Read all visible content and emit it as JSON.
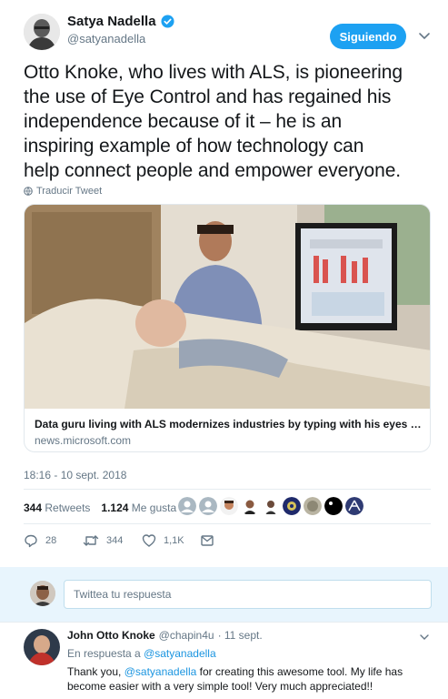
{
  "author": {
    "name": "Satya Nadella",
    "handle": "@satyanadella",
    "follow_label": "Siguiendo"
  },
  "tweet": {
    "text": "Otto Knoke, who lives with ALS, is pioneering\nthe use of Eye Control and has regained his\nindependence because of it – he is an\ninspiring example of how technology can\nhelp connect people and empower everyone.",
    "translate_label": "Traducir Tweet",
    "timestamp": "18:16 - 10 sept. 2018"
  },
  "card": {
    "title": "Data guru living with ALS modernizes industries by typing with his eyes - Sto...",
    "domain": "news.microsoft.com"
  },
  "stats": {
    "retweets_count": "344",
    "retweets_label": "Retweets",
    "likes_count": "1.124",
    "likes_label": "Me gusta"
  },
  "actions": {
    "reply_count": "28",
    "retweet_count": "344",
    "like_count": "1,1K"
  },
  "reply_box": {
    "placeholder": "Twittea tu respuesta"
  },
  "reply": {
    "name": "John Otto Knoke",
    "handle": "@chapin4u",
    "date": "· 11 sept.",
    "in_reply_prefix": "En respuesta a",
    "in_reply_handle": "@satyanadella",
    "text_prefix": "Thank you,",
    "text_handle": "@satyanadella",
    "text_rest": "for creating this awesome tool. My life has become easier with a very simple tool! Very much appreciated!!"
  },
  "colors": {
    "accent": "#1da1f2",
    "link": "#1b95e0",
    "muted": "#657786",
    "reply_bg": "#e8f5fd"
  },
  "icons": [
    "verified-badge-icon",
    "chevron-down-icon",
    "globe-icon",
    "reply-icon",
    "retweet-icon",
    "heart-icon",
    "direct-message-icon"
  ]
}
